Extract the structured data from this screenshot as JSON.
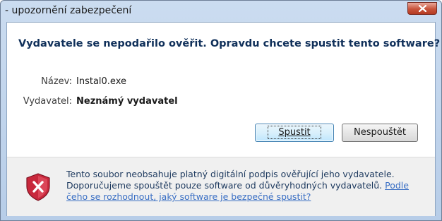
{
  "window": {
    "title": "- upozornění zabezpečení"
  },
  "dialog": {
    "headline": "Vydavatele se nepodařilo ověřit. Opravdu chcete spustit tento software?",
    "name_label": "Název:",
    "name_value": "Instal0.exe",
    "publisher_label": "Vydavatel:",
    "publisher_value": "Neznámý vydavatel"
  },
  "buttons": {
    "run": "Spustit",
    "dont_run": "Nespouštět"
  },
  "footer": {
    "text": "Tento soubor neobsahuje platný digitální podpis ověřující jeho vydavatele. Doporučujeme spouštět pouze software od důvěryhodných vydavatelů.",
    "link": "Podle čeho se rozhodnout, jaký software je bezpečné spustit?"
  },
  "icons": {
    "close": "close-icon",
    "warning": "shield-error-icon"
  },
  "colors": {
    "headline": "#10305a",
    "link": "#3a6fc4",
    "error_shield": "#c8283c"
  }
}
